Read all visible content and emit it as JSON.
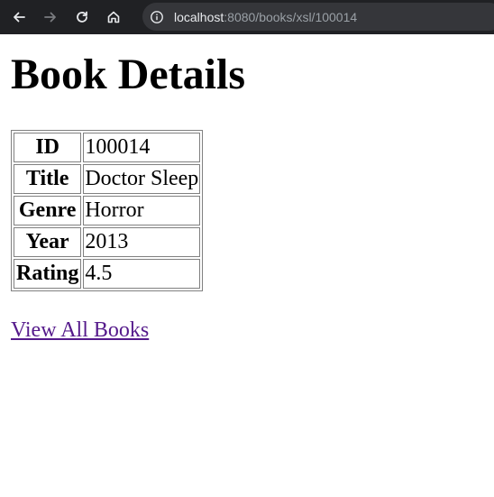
{
  "browser": {
    "url_host": "localhost",
    "url_rest": ":8080/books/xsl/100014"
  },
  "page": {
    "title": "Book Details",
    "rows": [
      {
        "label": "ID",
        "value": "100014"
      },
      {
        "label": "Title",
        "value": "Doctor Sleep"
      },
      {
        "label": "Genre",
        "value": "Horror"
      },
      {
        "label": "Year",
        "value": "2013"
      },
      {
        "label": "Rating",
        "value": "4.5"
      }
    ],
    "link_label": "View All Books"
  },
  "icons": {
    "back": "back-arrow-icon",
    "forward": "forward-arrow-icon",
    "reload": "reload-icon",
    "home": "home-icon",
    "info": "info-icon"
  },
  "colors": {
    "toolbar": "#202124",
    "omnibox": "#35363a",
    "link_visited": "#551a8b"
  }
}
